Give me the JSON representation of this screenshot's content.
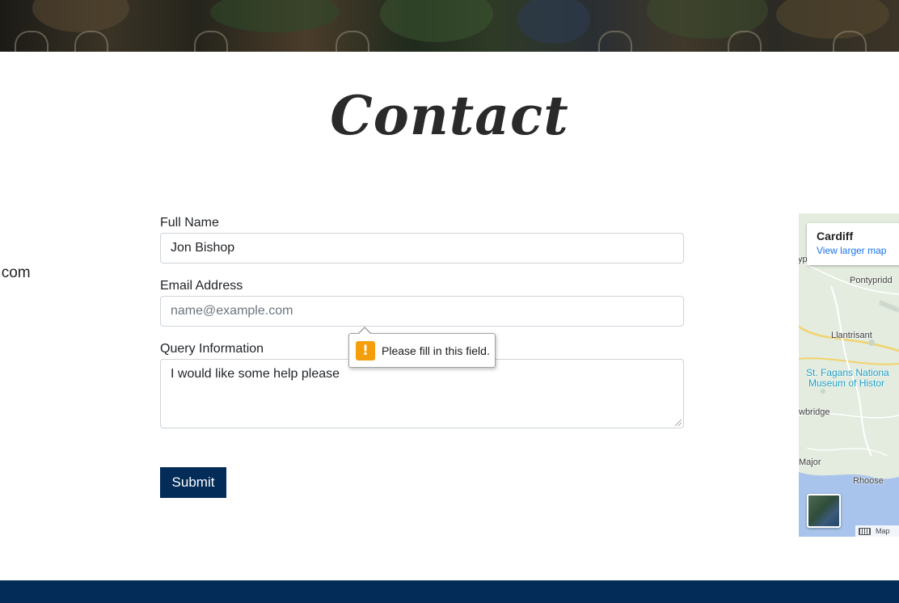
{
  "page": {
    "title": "Contact",
    "side_email_fragment": "ll.com"
  },
  "form": {
    "name_label": "Full Name",
    "name_value": "Jon Bishop",
    "email_label": "Email Address",
    "email_placeholder": "name@example.com",
    "email_value": "",
    "query_label": "Query Information",
    "query_value": "I would like some help please",
    "submit_label": "Submit"
  },
  "validation": {
    "message": "Please fill in this field.",
    "icon": "!"
  },
  "map": {
    "place_title": "Cardiff",
    "larger_map_link": "View larger map",
    "labels": {
      "pontypridd": "Pontypridd",
      "llantrisant": "Llantrisant",
      "st_fagans_1": "St. Fagans Nationa",
      "st_fagans_2": "Museum of Histor",
      "cowbridge": "wbridge",
      "major": "Major",
      "rhoose": "Rhoose",
      "left_edge": "yp"
    },
    "footer_label": "Map"
  },
  "colors": {
    "brand_navy": "#032c59",
    "warning": "#f59e0b",
    "link": "#1a73e8"
  }
}
